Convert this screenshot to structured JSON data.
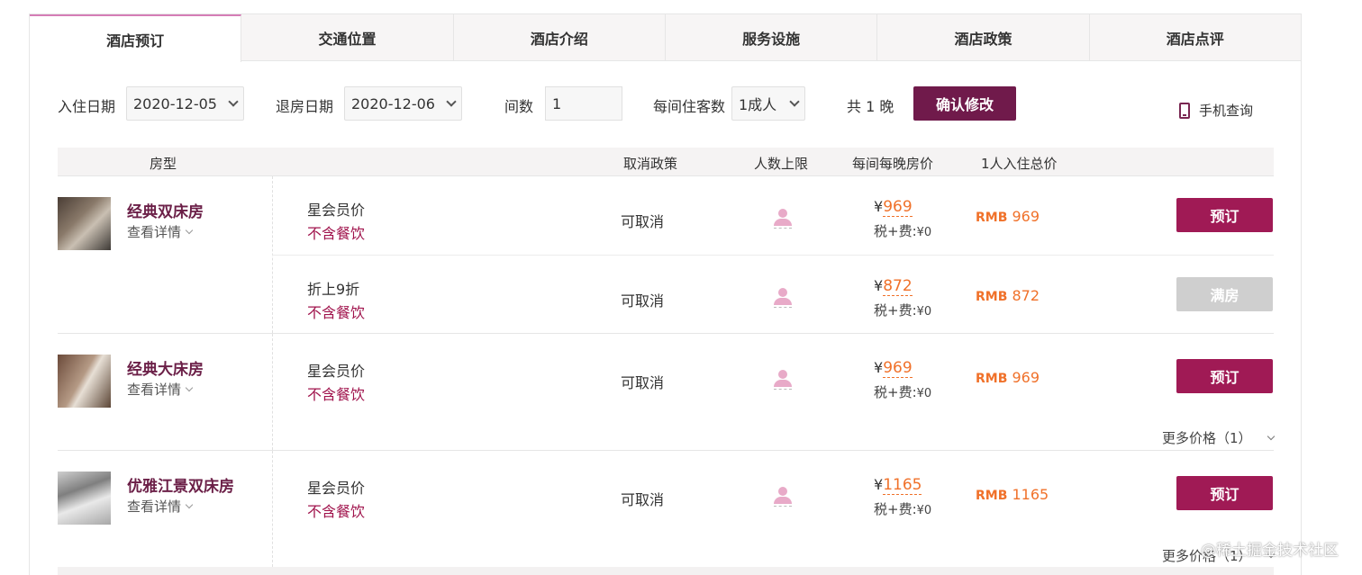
{
  "tabs": [
    "酒店预订",
    "交通位置",
    "酒店介绍",
    "服务设施",
    "酒店政策",
    "酒店点评"
  ],
  "search": {
    "checkin_label": "入住日期",
    "checkin_value": "2020-12-05",
    "checkout_label": "退房日期",
    "checkout_value": "2020-12-06",
    "rooms_label": "间数",
    "rooms_value": "1",
    "guests_label": "每间住客数",
    "guests_value": "1成人",
    "nights_text": "共 1 晚",
    "confirm_label": "确认修改",
    "mobile_label": "手机查询"
  },
  "table_headers": {
    "room_type": "房型",
    "cancel_policy": "取消政策",
    "max_people": "人数上限",
    "nightly_price": "每间每晚房价",
    "total_price": "1人入住总价"
  },
  "rooms": [
    {
      "name": "经典双床房",
      "detail_label": "查看详情",
      "rates": [
        {
          "rate_name": "星会员价",
          "meal": "不含餐饮",
          "cancel": "可取消",
          "currency": "¥",
          "price": "969",
          "tax_label": "税+费:",
          "tax_value": "¥0",
          "total_currency": "RMB",
          "total": "969",
          "action": "预订",
          "available": true
        },
        {
          "rate_name": "折上9折",
          "meal": "不含餐饮",
          "cancel": "可取消",
          "currency": "¥",
          "price": "872",
          "tax_label": "税+费:",
          "tax_value": "¥0",
          "total_currency": "RMB",
          "total": "872",
          "action": "满房",
          "available": false
        }
      ]
    },
    {
      "name": "经典大床房",
      "detail_label": "查看详情",
      "rates": [
        {
          "rate_name": "星会员价",
          "meal": "不含餐饮",
          "cancel": "可取消",
          "currency": "¥",
          "price": "969",
          "tax_label": "税+费:",
          "tax_value": "¥0",
          "total_currency": "RMB",
          "total": "969",
          "action": "预订",
          "available": true
        }
      ],
      "more_prices": "更多价格（1）"
    },
    {
      "name": "优雅江景双床房",
      "detail_label": "查看详情",
      "rates": [
        {
          "rate_name": "星会员价",
          "meal": "不含餐饮",
          "cancel": "可取消",
          "currency": "¥",
          "price": "1165",
          "tax_label": "税+费:",
          "tax_value": "¥0",
          "total_currency": "RMB",
          "total": "1165",
          "action": "预订",
          "available": true
        }
      ],
      "more_prices": "更多价格（1）"
    }
  ],
  "watermark": "@稀土掘金技术社区",
  "colors": {
    "brand": "#701a4b",
    "book_button": "#a01a55",
    "price": "#f0712a",
    "meal": "#a0134c",
    "disabled": "#cfcfcf",
    "active_tab_border": "#d57db6"
  }
}
